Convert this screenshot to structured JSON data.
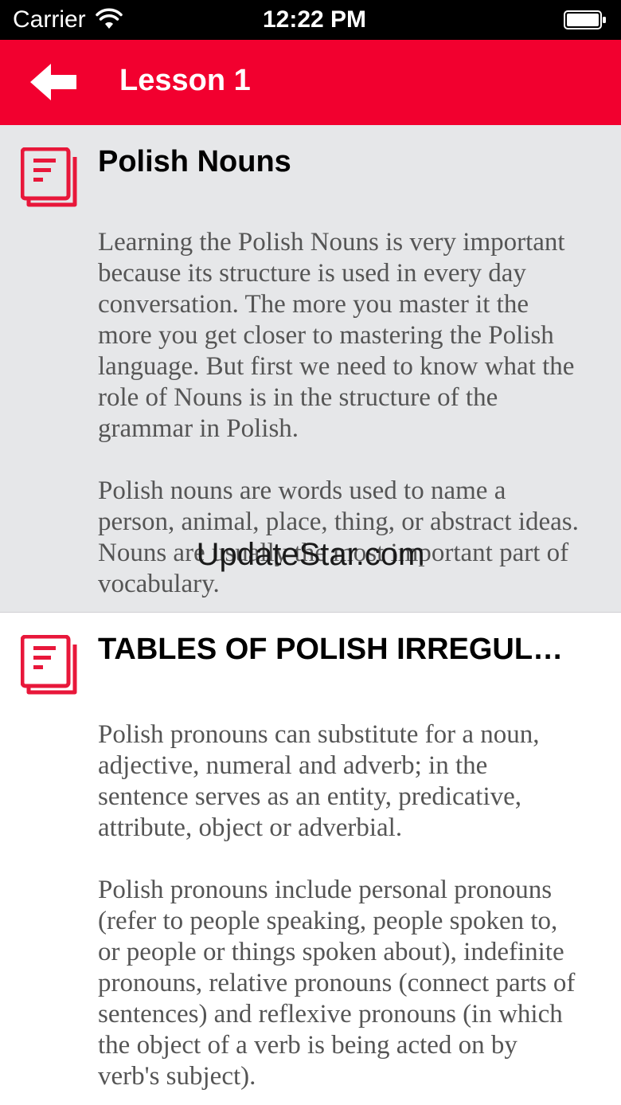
{
  "status_bar": {
    "carrier": "Carrier",
    "time": "12:22 PM"
  },
  "nav_bar": {
    "title": "Lesson 1",
    "background_color": "#f2002f"
  },
  "lessons": [
    {
      "title": "Polish Nouns",
      "paragraphs": [
        "Learning the Polish Nouns is very important because its structure is used in every day conversation.  The more you master it the more you get closer to mastering the Polish language. But first we need to know what the role of Nouns is in the structure of the grammar in Polish.",
        "Polish nouns are words used to name a person, animal, place, thing, or abstract ideas. Nouns are usually the most important part of vocabulary."
      ]
    },
    {
      "title": "TABLES OF POLISH IRREGULAR PRONOUNS",
      "paragraphs": [
        "Polish pronouns can substitute for a noun, adjective, numeral and adverb; in the sentence serves as an entity, predicative, attribute, object or adverbial.",
        "Polish pronouns include personal pronouns (refer to people speaking, people spoken to, or people or things spoken about), indefinite pronouns, relative pronouns (connect parts of sentences) and reflexive pronouns (in which the object of a verb is being acted on by verb's subject)."
      ]
    }
  ],
  "icons": {
    "back": "arrow-left-icon",
    "lesson": "book-icon"
  },
  "watermark": "UpdateStar.com",
  "accent_color": "#e8173a"
}
